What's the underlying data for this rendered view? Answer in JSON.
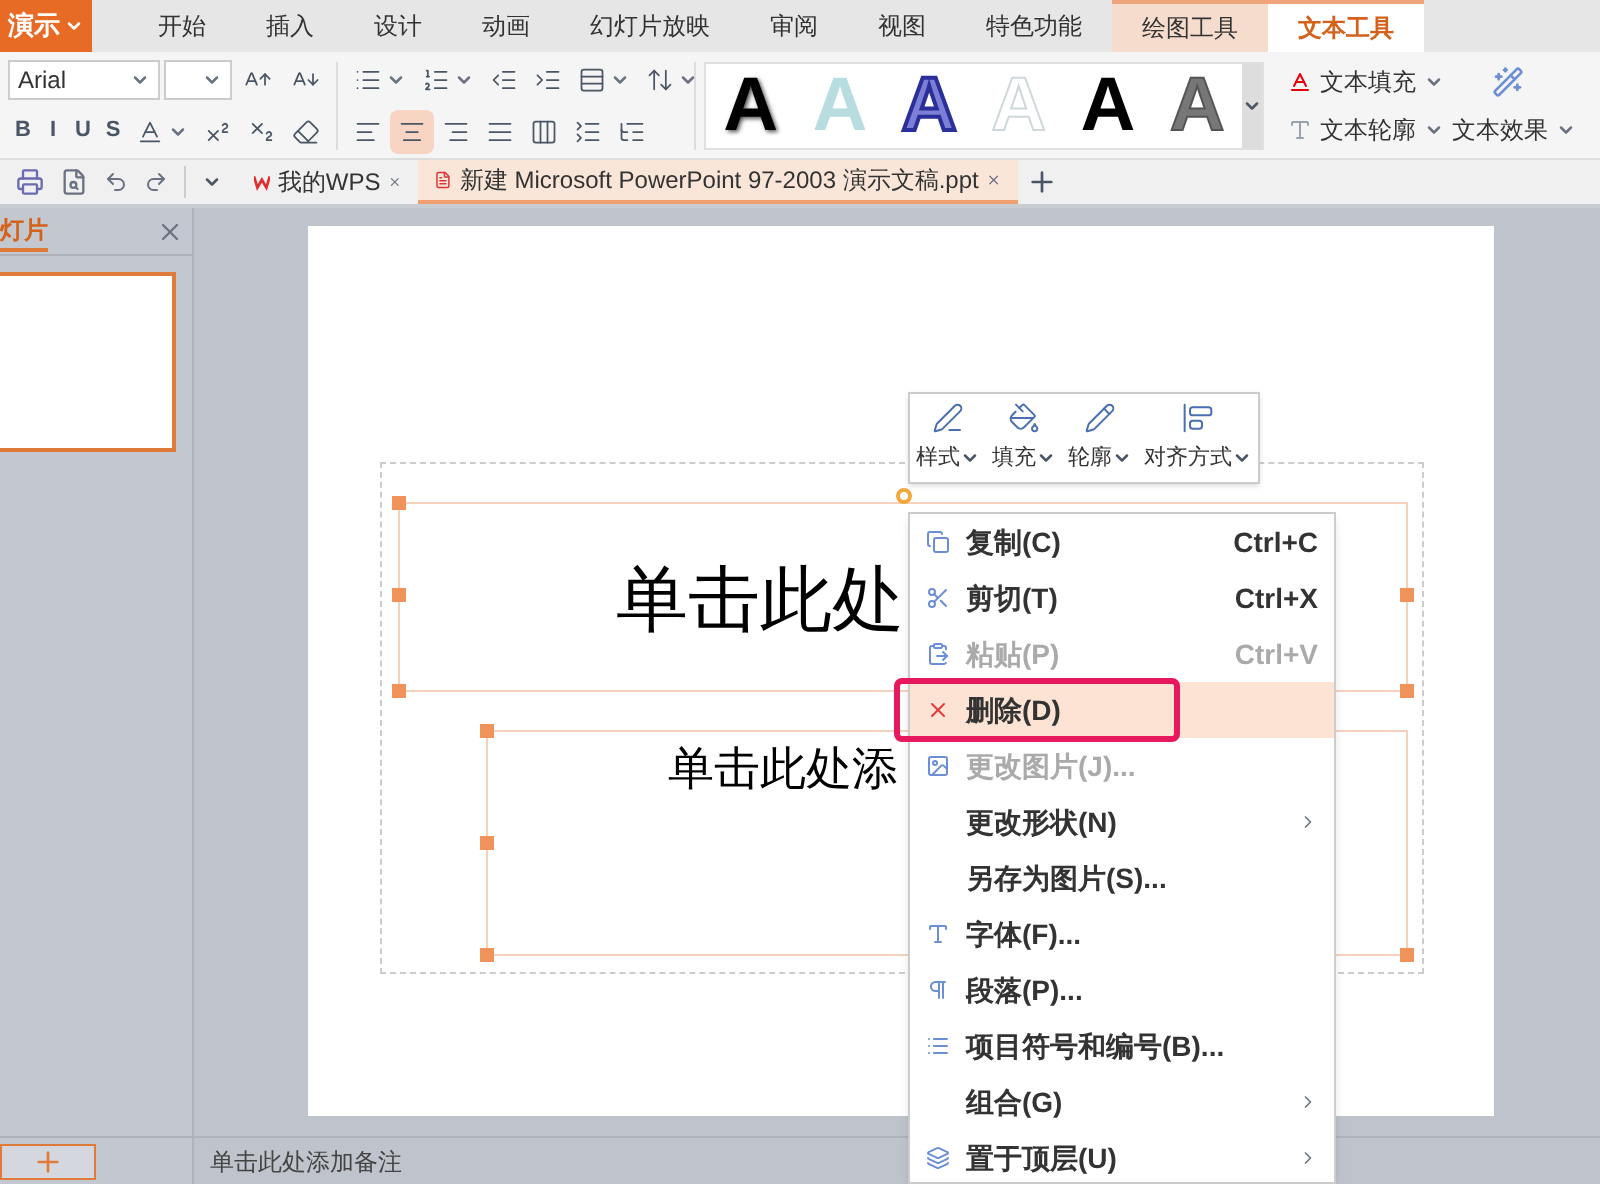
{
  "app_button": {
    "label": "演示"
  },
  "ribbon_tabs": [
    {
      "label": "开始",
      "selected": false,
      "kind": "plain"
    },
    {
      "label": "插入",
      "selected": false,
      "kind": "plain"
    },
    {
      "label": "设计",
      "selected": false,
      "kind": "plain"
    },
    {
      "label": "动画",
      "selected": false,
      "kind": "plain"
    },
    {
      "label": "幻灯片放映",
      "selected": false,
      "kind": "plain"
    },
    {
      "label": "审阅",
      "selected": false,
      "kind": "plain"
    },
    {
      "label": "视图",
      "selected": false,
      "kind": "plain"
    },
    {
      "label": "特色功能",
      "selected": false,
      "kind": "plain"
    },
    {
      "label": "绘图工具",
      "selected": false,
      "kind": "context"
    },
    {
      "label": "文本工具",
      "selected": true,
      "kind": "context"
    }
  ],
  "font": {
    "name": "Arial"
  },
  "format_buttons": [
    "B",
    "I",
    "U",
    "S"
  ],
  "align_buttons": [
    {
      "selected": false
    },
    {
      "selected": true
    },
    {
      "selected": false
    },
    {
      "selected": false
    },
    {
      "selected": false
    }
  ],
  "text_styles": [
    {
      "label": "A",
      "kind": "solid"
    },
    {
      "label": "A",
      "kind": "pale"
    },
    {
      "label": "A",
      "kind": "outline"
    },
    {
      "label": "A",
      "kind": "ghost"
    },
    {
      "label": "A",
      "kind": "flat"
    },
    {
      "label": "A",
      "kind": "gradient"
    }
  ],
  "text_commands": [
    "文本填充",
    "文本轮廓",
    "文本效果"
  ],
  "doc_tabs": [
    {
      "label": "我的WPS",
      "selected": false,
      "kind": "home"
    },
    {
      "label": "新建 Microsoft PowerPoint 97-2003 演示文稿.ppt",
      "selected": true,
      "kind": "file"
    }
  ],
  "slide_panel": {
    "title": "灯片",
    "slides": [
      {
        "selected": true
      }
    ]
  },
  "slide": {
    "title": "单击此处",
    "subtitle": "单击此处添"
  },
  "mini_toolbar": [
    "样式",
    "填充",
    "轮廓",
    "对齐方式"
  ],
  "context_menu": [
    {
      "label": "复制(C)",
      "shortcut": "Ctrl+C",
      "disabled": false,
      "selected": false,
      "boxed": false,
      "submenu": false
    },
    {
      "label": "剪切(T)",
      "shortcut": "Ctrl+X",
      "disabled": false,
      "selected": false,
      "boxed": false,
      "submenu": false
    },
    {
      "label": "粘贴(P)",
      "shortcut": "Ctrl+V",
      "disabled": true,
      "selected": false,
      "boxed": false,
      "submenu": false
    },
    {
      "label": "删除(D)",
      "disabled": false,
      "selected": true,
      "boxed": true,
      "submenu": false
    },
    {
      "label": "更改图片(J)...",
      "disabled": true,
      "selected": false,
      "boxed": false,
      "submenu": false
    },
    {
      "label": "更改形状(N)",
      "disabled": false,
      "selected": false,
      "boxed": false,
      "submenu": true
    },
    {
      "label": "另存为图片(S)...",
      "disabled": false,
      "selected": false,
      "boxed": false,
      "submenu": false
    },
    {
      "label": "字体(F)...",
      "disabled": false,
      "selected": false,
      "boxed": false,
      "submenu": false
    },
    {
      "label": "段落(P)...",
      "disabled": false,
      "selected": false,
      "boxed": false,
      "submenu": false
    },
    {
      "label": "项目符号和编号(B)...",
      "disabled": false,
      "selected": false,
      "boxed": false,
      "submenu": false
    },
    {
      "label": "组合(G)",
      "disabled": false,
      "selected": false,
      "boxed": false,
      "submenu": true
    },
    {
      "label": "置于顶层(U)",
      "disabled": false,
      "selected": false,
      "boxed": false,
      "submenu": true
    }
  ],
  "notes": {
    "placeholder": "单击此处添加备注"
  }
}
